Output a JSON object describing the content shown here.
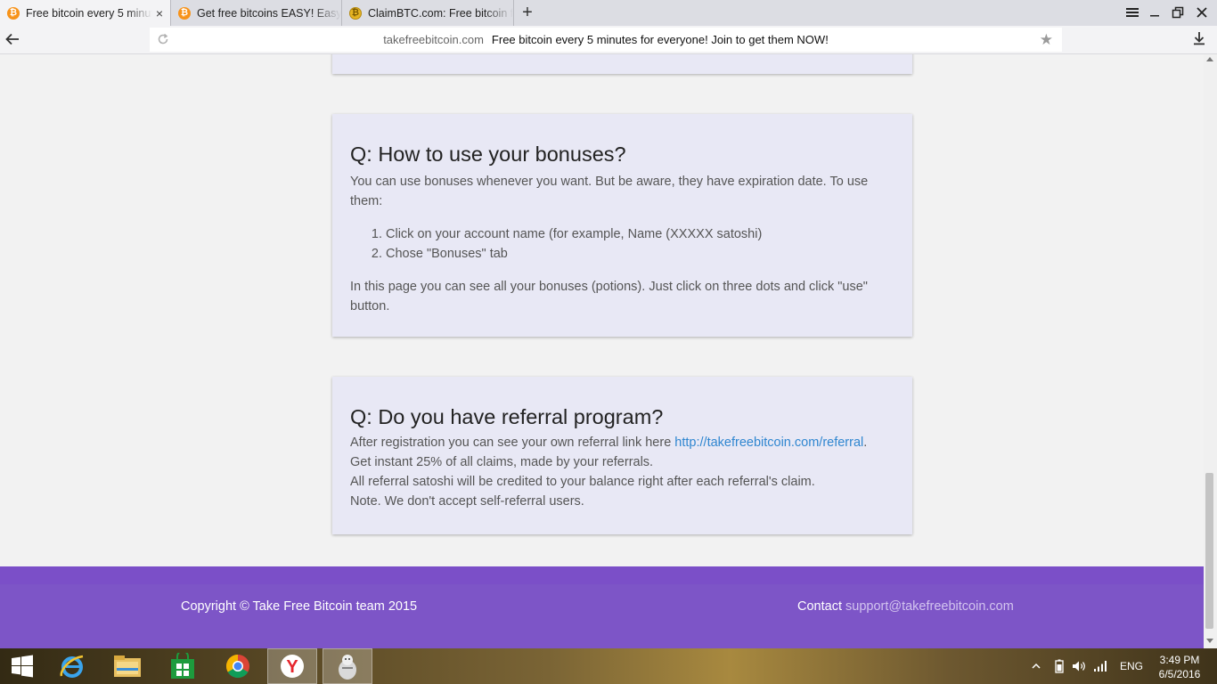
{
  "browser": {
    "tabs": [
      {
        "label": "Free bitcoin every 5 minutes for everyone! Join to get them NOW!",
        "icon": "bitcoin-icon",
        "active": true
      },
      {
        "label": "Get free bitcoins EASY! Easy Bitcoin Faucet",
        "icon": "bitcoin-icon",
        "active": false
      },
      {
        "label": "ClaimBTC.com: Free bitcoin faucet",
        "icon": "coin-icon",
        "active": false
      }
    ],
    "tab_close_glyph": "×",
    "new_tab_glyph": "+",
    "address": {
      "domain": "takefreebitcoin.com",
      "title": "Free bitcoin every 5 minutes for everyone! Join to get them NOW!"
    },
    "bookmark_star_glyph": "★"
  },
  "faq": [
    {
      "question": "Q: How to use your bonuses?",
      "intro": "You can use bonuses whenever you want. But be aware, they have expiration date. To use them:",
      "steps": [
        "Click on your account name (for example, Name (XXXXX satoshi)",
        "Chose \"Bonuses\" tab"
      ],
      "outro": "In this page you can see all your bonuses (potions). Just click on three dots and click \"use\" button."
    },
    {
      "question": "Q: Do you have referral program?",
      "line1_prefix": "After registration you can see your own referral link here ",
      "referral_link": "http://takefreebitcoin.com/referral",
      "line1_suffix": ".",
      "lines": [
        "Get instant 25% of all claims, made by your referrals.",
        "All referral satoshi will be credited to your balance right after each referral's claim.",
        "Note. We don't accept self-referral users."
      ]
    }
  ],
  "footer": {
    "copyright": "Copyright © Take Free Bitcoin team 2015",
    "contact_label": "Contact ",
    "contact_email": "support@takefreebitcoin.com"
  },
  "taskbar": {
    "apps": [
      "start-button",
      "internet-explorer",
      "file-explorer",
      "store",
      "chrome",
      "yandex-browser",
      "game-app"
    ],
    "tray": {
      "language": "ENG",
      "time": "3:49 PM",
      "date": "6/5/2016"
    }
  },
  "colors": {
    "card_bg": "#e8e8f5",
    "footer_bg": "#7d55c7",
    "link": "#2f86d0",
    "page_bg": "#f2f2f2"
  }
}
